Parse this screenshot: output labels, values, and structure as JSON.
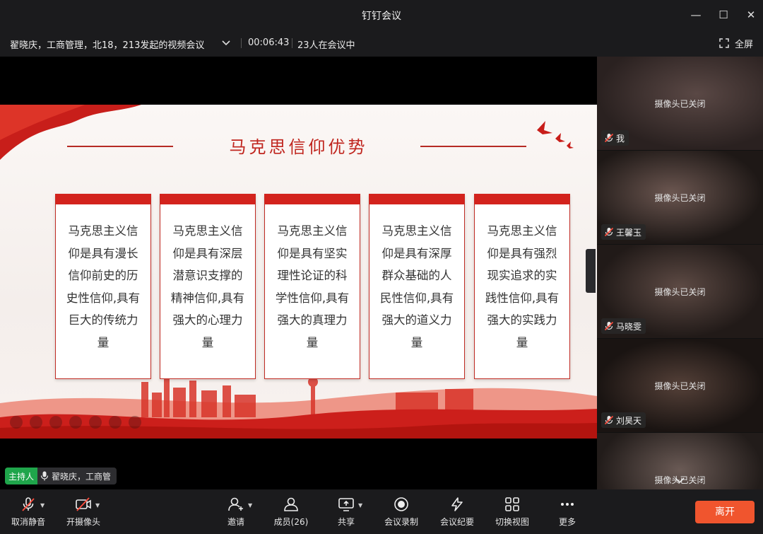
{
  "window": {
    "title": "钉钉会议",
    "minimize_glyph": "—",
    "maximize_glyph": "☐",
    "close_glyph": "✕"
  },
  "meeting": {
    "name": "翟晓庆，工商管理，北18，213发起的视频会议",
    "duration": "00:06:43",
    "participants_text": "23人在会议中",
    "fullscreen_label": "全屏"
  },
  "slide": {
    "title": "马克思信仰优势",
    "cards": [
      "马克思主义信仰是具有漫长信仰前史的历史性信仰,具有巨大的传统力量",
      "马克思主义信仰是具有深层潜意识支撑的精神信仰,具有强大的心理力量",
      "马克思主义信仰是具有坚实理性论证的科学性信仰,具有强大的真理力量",
      "马克思主义信仰是具有深厚群众基础的人民性信仰,具有强大的道义力量",
      "马克思主义信仰是具有强烈现实追求的实践性信仰,具有强大的实践力量"
    ],
    "accent_color": "#d3231d"
  },
  "host": {
    "tag": "主持人",
    "name": "翟晓庆，工商管"
  },
  "gallery": {
    "camera_off_text": "摄像头已关闭",
    "tiles": [
      {
        "name": "我"
      },
      {
        "name": "王馨玉"
      },
      {
        "name": "马晓雯"
      },
      {
        "name": "刘昊天"
      },
      {
        "name": ""
      }
    ]
  },
  "toolbar": {
    "mute": "取消静音",
    "camera": "开摄像头",
    "invite": "邀请",
    "members": "成员(26)",
    "share": "共享",
    "record": "会议录制",
    "minutes": "会议纪要",
    "view": "切换视图",
    "more": "更多",
    "leave": "离开",
    "leave_color": "#f0552e"
  }
}
